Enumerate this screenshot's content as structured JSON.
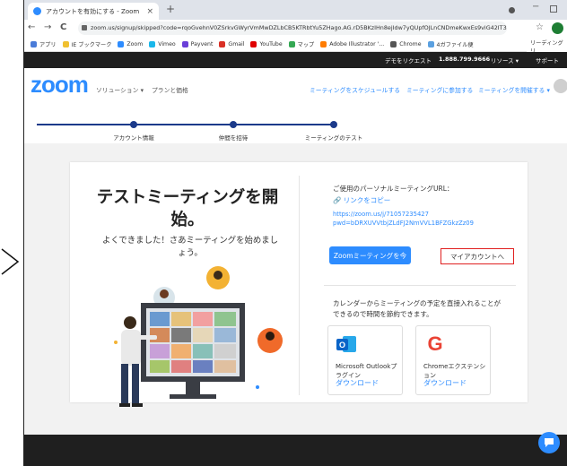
{
  "browser": {
    "tab_title": "アカウントを有効にする - Zoom",
    "tab_close": "×",
    "new_tab": "+",
    "nav_back": "←",
    "nav_forward": "→",
    "nav_reload": "C",
    "url": "zoom.us/signup/skipped?code=rqoGvehnV0ZSrkvGWyrVmMwDZLbCB5KTRbtYu5ZHago.AG.rD5BKzIHn8ejIdw7yQUpfOJLnCNDmeKwxEs9viG42IT3ZGgxlO9Xl59...",
    "star": "☆",
    "reading_list": "リーディング リ",
    "bookmarks": [
      {
        "label": "アプリ",
        "color": "#4a7bd8"
      },
      {
        "label": "IE ブックマーク",
        "color": "#f0c030"
      },
      {
        "label": "Zoom",
        "color": "#2d8cff"
      },
      {
        "label": "Vimeo",
        "color": "#1ab7ea"
      },
      {
        "label": "Payvent",
        "color": "#6a3fd8"
      },
      {
        "label": "Gmail",
        "color": "#d93025"
      },
      {
        "label": "YouTube",
        "color": "#e00000"
      },
      {
        "label": "マップ",
        "color": "#34a853"
      },
      {
        "label": "Adobe Illustrator '...",
        "color": "#ff7c00"
      },
      {
        "label": "Chrome",
        "color": "#555555"
      },
      {
        "label": "4ガファイル便",
        "color": "#5aa0e0"
      }
    ]
  },
  "zoom": {
    "top_strip": {
      "demo_request": "デモをリクエスト",
      "phone": "1.888.799.9666",
      "resources": "リソース ▾",
      "support": "サポート"
    },
    "logo": "zoom",
    "nav": {
      "solutions": "ソリューション ▾",
      "plans": "プランと価格",
      "schedule": "ミーティングをスケジュールする",
      "join": "ミーティングに参加する",
      "host": "ミーティングを開催する ▾"
    },
    "progress": [
      {
        "label": "アカウント情報"
      },
      {
        "label": "仲間を招待"
      },
      {
        "label": "ミーティングのテスト"
      }
    ],
    "left_panel": {
      "heading_line1": "テストミーティングを開",
      "heading_line2": "始。",
      "subtext_line1": "よくできました！さあミーティングを始めまし",
      "subtext_line2": "ょう。"
    },
    "right_panel": {
      "personal_url_label": "ご使用のパーソナルミーティングURL：",
      "copy_link": "🔗 リンクをコピー",
      "personal_url_line1": "https://zoom.us/j/71057235427",
      "personal_url_line2": "pwd=bDRXUVVtbjZLdFJ2NmVVL1BFZGkzZz09",
      "start_button": "Zoomミーティングを今",
      "account_button": "マイアカウントへ",
      "calendar_text_line1": "カレンダーからミーティングの予定を直接入れることが",
      "calendar_text_line2": "できるので時間を節約できます。",
      "apps": [
        {
          "name_line1": "Microsoft Outlookプ",
          "name_line2": "ラグイン",
          "download": "ダウンロード",
          "icon_letter": "O",
          "icon_color": "#0a64c8"
        },
        {
          "name_line1": "Chromeエクステンシ",
          "name_line2": "ョン",
          "download": "ダウンロード",
          "icon_letter": "G",
          "icon_color": "#ea4335"
        }
      ]
    }
  }
}
